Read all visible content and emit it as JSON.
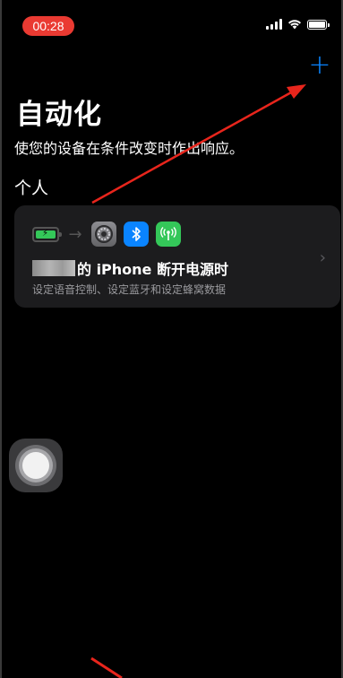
{
  "status_bar": {
    "time": "00:28",
    "time_pill_color": "#ea3a32",
    "icons": [
      "signal-icon",
      "wifi-icon",
      "battery-icon"
    ]
  },
  "toolbar": {
    "add_label": "+",
    "accent_color": "#0a84ff"
  },
  "page": {
    "title": "自动化",
    "subtitle": "使您的设备在条件改变时作出响应。"
  },
  "section": {
    "header": "个人"
  },
  "automation_card": {
    "trigger_icons": [
      "battery-charging-icon",
      "arrow-right-icon",
      "settings-icon",
      "bluetooth-icon",
      "cellular-icon"
    ],
    "title": "的 iPhone 断开电源时",
    "description": "设定语音控制、设定蓝牙和设定蜂窝数据",
    "chevron": "›"
  },
  "assistive_touch": {
    "icon": "assistive-touch-icon"
  },
  "annotations": {
    "arrow_color": "#e8251c"
  }
}
